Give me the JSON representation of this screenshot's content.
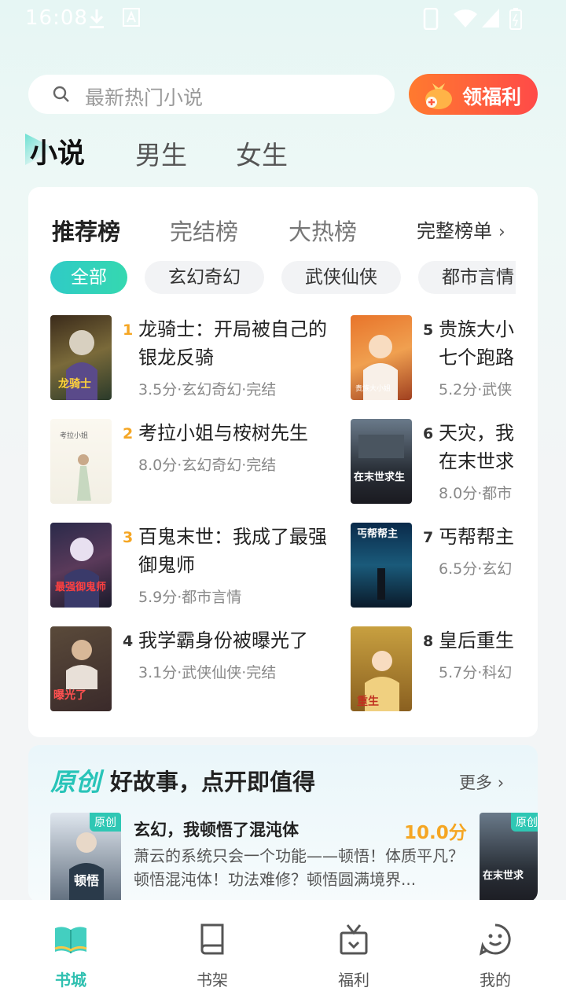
{
  "status_bar": {
    "time": "16:08"
  },
  "search": {
    "placeholder": "最新热门小说"
  },
  "welfare_button": {
    "label": "领福利"
  },
  "category_tabs": [
    {
      "label": "小说",
      "active": true
    },
    {
      "label": "男生",
      "active": false
    },
    {
      "label": "女生",
      "active": false
    }
  ],
  "ranking": {
    "tabs": [
      {
        "label": "推荐榜",
        "active": true
      },
      {
        "label": "完结榜",
        "active": false
      },
      {
        "label": "大热榜",
        "active": false
      }
    ],
    "full_list_label": "完整榜单",
    "chips": [
      {
        "label": "全部",
        "active": true
      },
      {
        "label": "玄幻奇幻",
        "active": false
      },
      {
        "label": "武侠仙侠",
        "active": false
      },
      {
        "label": "都市言情",
        "active": false
      }
    ],
    "books": [
      {
        "rank": "1",
        "title": "龙骑士：开局被自己的银龙反骑",
        "meta": "3.5分·玄幻奇幻·完结"
      },
      {
        "rank": "2",
        "title": "考拉小姐与桉树先生",
        "meta": "8.0分·玄幻奇幻·完结"
      },
      {
        "rank": "3",
        "title": "百鬼末世：我成了最强御鬼师",
        "meta": "5.9分·都市言情"
      },
      {
        "rank": "4",
        "title": "我学霸身份被曝光了",
        "meta": "3.1分·武侠仙侠·完结"
      },
      {
        "rank": "5",
        "title": "贵族大小七个跑路",
        "meta": "5.2分·武侠"
      },
      {
        "rank": "6",
        "title": "天灾，我在末世求",
        "meta": "8.0分·都市"
      },
      {
        "rank": "7",
        "title": "丐帮帮主",
        "meta": "6.5分·玄幻"
      },
      {
        "rank": "8",
        "title": "皇后重生",
        "meta": "5.7分·科幻"
      }
    ],
    "rank_colors": {
      "top": "#f5a623",
      "normal": "#333333"
    }
  },
  "original": {
    "brand": "原创",
    "slogan": "好故事，点开即值得",
    "more_label": "更多",
    "badge": "原创",
    "featured": {
      "title": "玄幻，我顿悟了混沌体",
      "score": "10.0分",
      "desc": "萧云的系统只会一个功能——顿悟！体质平凡？顿悟混沌体！功法难修？顿悟圆满境界..."
    }
  },
  "bottom_nav": [
    {
      "label": "书城",
      "icon": "open-book-icon",
      "active": true
    },
    {
      "label": "书架",
      "icon": "book-icon",
      "active": false
    },
    {
      "label": "福利",
      "icon": "gift-icon",
      "active": false
    },
    {
      "label": "我的",
      "icon": "smiley-icon",
      "active": false
    }
  ],
  "colors": {
    "accent": "#2fc0b0",
    "welfare": "#ff5a40",
    "score": "#f5a623"
  }
}
